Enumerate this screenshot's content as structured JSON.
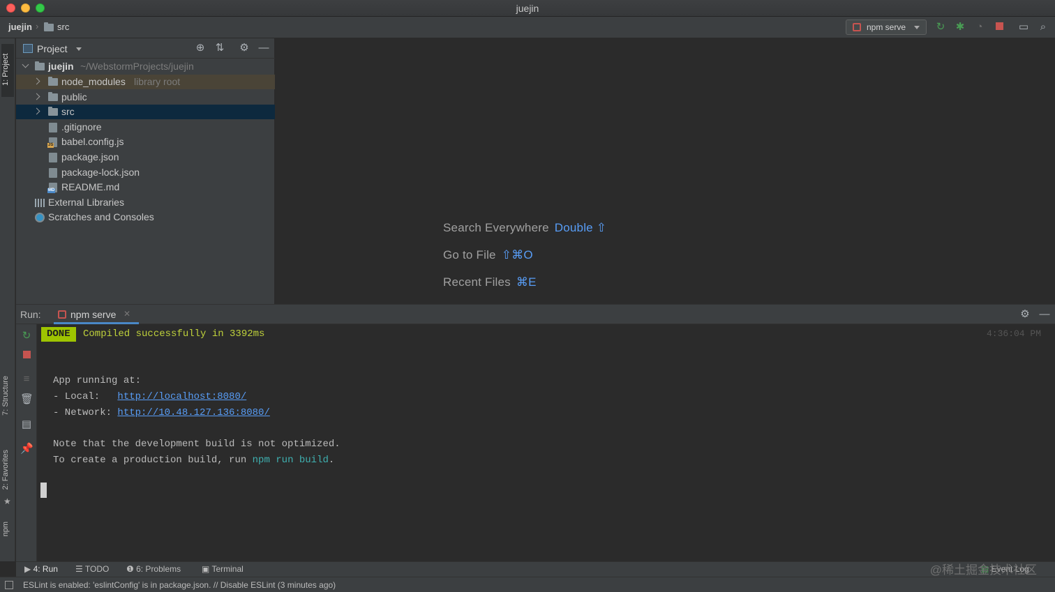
{
  "window": {
    "title": "juejin"
  },
  "navbar": {
    "root": "juejin",
    "folder": "src",
    "run_config": "npm serve"
  },
  "left_strip": {
    "project_tab": "1: Project",
    "structure_tab": "7: Structure",
    "favorites_tab": "2: Favorites",
    "npm_tab": "npm"
  },
  "project_panel": {
    "title": "Project",
    "tree": [
      {
        "label": "juejin",
        "hint": "~/WebstormProjects/juejin",
        "type": "root-folder"
      },
      {
        "label": "node_modules",
        "hint": "library root",
        "type": "folder"
      },
      {
        "label": "public",
        "hint": "",
        "type": "folder"
      },
      {
        "label": "src",
        "hint": "",
        "type": "folder"
      },
      {
        "label": ".gitignore",
        "type": "file"
      },
      {
        "label": "babel.config.js",
        "type": "js-file"
      },
      {
        "label": "package.json",
        "type": "file"
      },
      {
        "label": "package-lock.json",
        "type": "file"
      },
      {
        "label": "README.md",
        "type": "md-file"
      },
      {
        "label": "External Libraries",
        "type": "libraries"
      },
      {
        "label": "Scratches and Consoles",
        "type": "scratches"
      }
    ]
  },
  "editor": {
    "hints": [
      {
        "label": "Search Everywhere",
        "key": "Double ⇧"
      },
      {
        "label": "Go to File",
        "key": "⇧⌘O"
      },
      {
        "label": "Recent Files",
        "key": "⌘E"
      }
    ]
  },
  "run_panel": {
    "label": "Run:",
    "tab": "npm serve",
    "done_badge": "DONE",
    "done_text": "Compiled successfully in 3392ms",
    "timestamp": "4:36:04 PM",
    "app_running": "App running at:",
    "local_prefix": "- Local:   ",
    "local_url": "http://localhost:8080/",
    "network_prefix": "- Network: ",
    "network_url": "http://10.48.127.136:8080/",
    "note_line": "Note that the development build is not optimized.",
    "build_prefix": "To create a production build, run ",
    "build_cmd": "npm run build",
    "build_suffix": "."
  },
  "bottom_tools": {
    "run": "4: Run",
    "todo": "TODO",
    "problems": "6: Problems",
    "terminal": "Terminal",
    "event_log": "Event Log"
  },
  "status": {
    "message": "ESLint is enabled: 'eslintConfig' is in package.json. // Disable ESLint (3 minutes ago)"
  },
  "watermark": "@稀土掘金技术社区",
  "colors": {
    "accent": "#4a88c7",
    "selection": "#0d293e",
    "done_badge": "#9ec400",
    "link": "#589df6",
    "run_green": "#499c54",
    "stop_red": "#c75450"
  }
}
